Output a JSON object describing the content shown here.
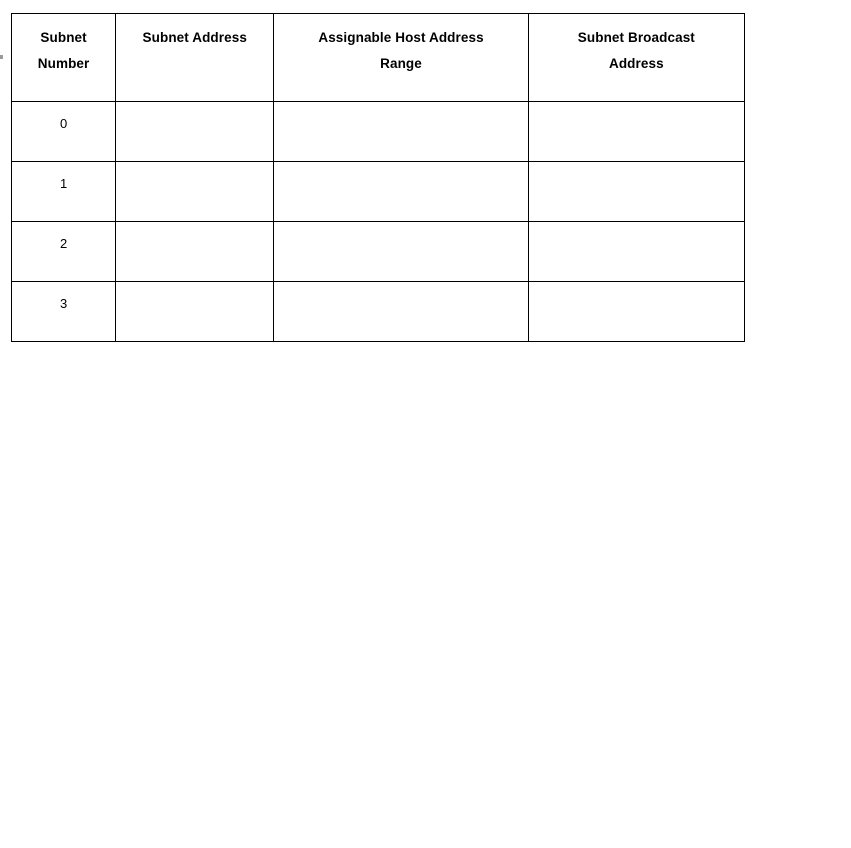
{
  "document": {
    "type": "worksheet-table",
    "background_color": "#ffffff",
    "text_color": "#000000",
    "border_color": "#000000"
  },
  "table": {
    "name": "subnet-planning-table",
    "columns": [
      {
        "key": "subnet_number",
        "header": "Subnet Number"
      },
      {
        "key": "subnet_address",
        "header": "Subnet Address"
      },
      {
        "key": "host_range",
        "header": "Assignable Host Address Range"
      },
      {
        "key": "broadcast_address",
        "header": "Subnet Broadcast Address"
      }
    ],
    "header_lines": [
      [
        "Subnet",
        "Number"
      ],
      [
        "Subnet Address",
        ""
      ],
      [
        "Assignable Host Address",
        "Range"
      ],
      [
        "Subnet Broadcast",
        "Address"
      ]
    ],
    "rows": [
      {
        "subnet_number": "0",
        "subnet_address": "",
        "host_range": "",
        "broadcast_address": ""
      },
      {
        "subnet_number": "1",
        "subnet_address": "",
        "host_range": "",
        "broadcast_address": ""
      },
      {
        "subnet_number": "2",
        "subnet_address": "",
        "host_range": "",
        "broadcast_address": ""
      },
      {
        "subnet_number": "3",
        "subnet_address": "",
        "host_range": "",
        "broadcast_address": ""
      }
    ],
    "row_count": 4,
    "column_count": 4
  }
}
